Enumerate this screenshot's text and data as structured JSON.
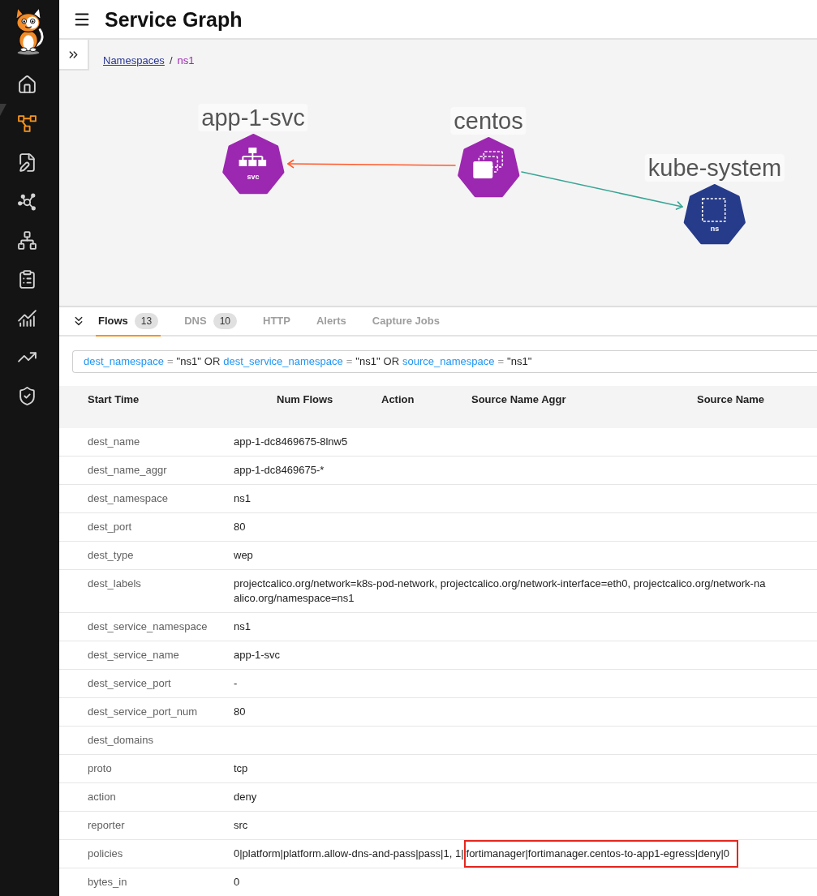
{
  "sidebar": {
    "items": [
      {
        "selected": false
      },
      {
        "selected": true
      },
      {
        "selected": false
      },
      {
        "selected": false
      },
      {
        "selected": false
      },
      {
        "selected": false
      },
      {
        "selected": false
      },
      {
        "selected": false
      },
      {
        "selected": false
      }
    ]
  },
  "header": {
    "title": "Service Graph"
  },
  "breadcrumb": {
    "items": [
      {
        "label": "Namespaces",
        "kind": "link"
      },
      {
        "label": "ns1",
        "kind": "current"
      }
    ],
    "separator": "/"
  },
  "graph": {
    "nodes": [
      {
        "label": "app-1-svc",
        "kind": "service",
        "badge": "svc",
        "color": "#9c27b0"
      },
      {
        "label": "centos",
        "kind": "pods",
        "color": "#9c27b0"
      },
      {
        "label": "kube-system",
        "kind": "namespace",
        "badge": "ns",
        "color": "#263b8a"
      }
    ],
    "edges": [
      {
        "color": "#ff5a2c"
      },
      {
        "color": "#3aa595"
      }
    ]
  },
  "tabs": [
    {
      "label": "Flows",
      "count": "13",
      "selected": true
    },
    {
      "label": "DNS",
      "count": "10",
      "selected": false
    },
    {
      "label": "HTTP",
      "selected": false
    },
    {
      "label": "Alerts",
      "selected": false
    },
    {
      "label": "Capture Jobs",
      "selected": false
    }
  ],
  "filter": {
    "tokens": [
      {
        "kind": "field",
        "text": "dest_namespace"
      },
      {
        "kind": "operator",
        "text": "="
      },
      {
        "kind": "value",
        "text": "\"ns1\""
      },
      {
        "kind": "keyword",
        "text": "OR"
      },
      {
        "kind": "field",
        "text": "dest_service_namespace"
      },
      {
        "kind": "operator",
        "text": "="
      },
      {
        "kind": "value",
        "text": "\"ns1\""
      },
      {
        "kind": "keyword",
        "text": "OR"
      },
      {
        "kind": "field",
        "text": "source_namespace"
      },
      {
        "kind": "operator",
        "text": "="
      },
      {
        "kind": "value",
        "text": "\"ns1\""
      }
    ]
  },
  "table": {
    "columns": [
      "Start Time",
      "Num Flows",
      "Action",
      "Source Name Aggr",
      "Source Name"
    ],
    "details": [
      {
        "key": "dest_name",
        "value": "app-1-dc8469675-8lnw5"
      },
      {
        "key": "dest_name_aggr",
        "value": "app-1-dc8469675-*"
      },
      {
        "key": "dest_namespace",
        "value": "ns1"
      },
      {
        "key": "dest_port",
        "value": "80"
      },
      {
        "key": "dest_type",
        "value": "wep"
      },
      {
        "key": "dest_labels",
        "lines": [
          "projectcalico.org/network=k8s-pod-network, projectcalico.org/network-interface=eth0, projectcalico.org/network-na",
          "alico.org/namespace=ns1"
        ]
      },
      {
        "key": "dest_service_namespace",
        "value": "ns1"
      },
      {
        "key": "dest_service_name",
        "value": "app-1-svc"
      },
      {
        "key": "dest_service_port",
        "value": "-"
      },
      {
        "key": "dest_service_port_num",
        "value": "80"
      },
      {
        "key": "dest_domains"
      },
      {
        "key": "proto",
        "value": "tcp"
      },
      {
        "key": "action",
        "value": "deny"
      },
      {
        "key": "reporter",
        "value": "src"
      },
      {
        "key": "policies",
        "value": "0|platform|platform.allow-dns-and-pass|pass|1, 1|",
        "highlighted": "fortimanager|fortimanager.centos-to-app1-egress|deny|0"
      },
      {
        "key": "bytes_in",
        "value": "0"
      }
    ]
  }
}
